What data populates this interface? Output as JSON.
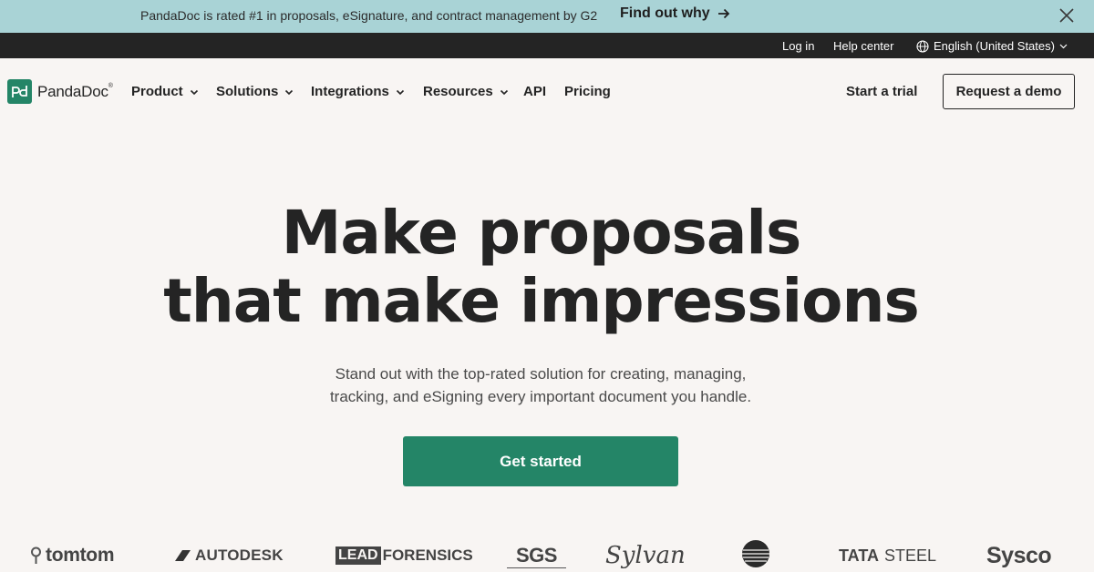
{
  "announcement": {
    "text": "PandaDoc is rated #1 in proposals, eSignature, and contract management by G2",
    "link_label": "Find out why"
  },
  "utility": {
    "login": "Log in",
    "help": "Help center",
    "language": "English (United States)"
  },
  "nav": {
    "logo": "PandaDoc",
    "items": [
      {
        "label": "Product"
      },
      {
        "label": "Solutions"
      },
      {
        "label": "Integrations"
      },
      {
        "label": "Resources"
      },
      {
        "label": "API"
      },
      {
        "label": "Pricing"
      }
    ],
    "trial": "Start a trial",
    "demo": "Request a demo"
  },
  "hero": {
    "title_line1": "Make proposals",
    "title_line2": "that make impressions",
    "subtitle_line1": "Stand out with the top-rated solution for creating, managing,",
    "subtitle_line2": "tracking, and eSigning every important document you handle.",
    "cta": "Get started"
  },
  "brands": {
    "tomtom": "tomtom",
    "autodesk": "AUTODESK",
    "lead": "LEAD",
    "forensics": "FORENSICS",
    "sgs": "SGS",
    "sylvan": "Sylvan",
    "tata": "TATA",
    "steel": "STEEL",
    "sysco": "Sysco"
  },
  "colors": {
    "announcement_bg": "#a9d3d6",
    "utility_bg": "#242424",
    "page_bg": "#f8f5f3",
    "brand_green": "#248567"
  }
}
